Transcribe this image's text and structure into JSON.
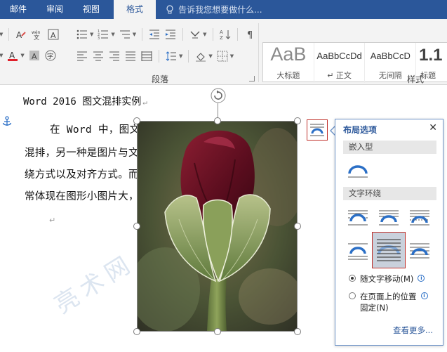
{
  "tabs": [
    {
      "label": "邮件"
    },
    {
      "label": "审阅"
    },
    {
      "label": "视图"
    },
    {
      "label": "格式",
      "active": true
    }
  ],
  "tell_me": {
    "text": "告诉我您想要做什么..."
  },
  "ribbon": {
    "paragraph_group_label": "段落",
    "styles_group_label": "样式",
    "styles": [
      {
        "sample": "AaB",
        "name": "大标题"
      },
      {
        "sample": "AaBbCcDd",
        "name": "↵ 正文"
      },
      {
        "sample": "AaBbCcD",
        "name": "无间隔"
      },
      {
        "sample": "1.1",
        "name": "标题"
      }
    ]
  },
  "document": {
    "title": "Word 2016 图文混排实例",
    "lines": [
      "在 Word 中，图文混排有两种情况，一种是图",
      "混排，另一种是图片与文字混排。二者与文字混排主要",
      "绕方式以及对齐方式。而图形与文字混排跟图片与文字",
      "常体现在图形小图片大，对于太大的图片需要把它适当"
    ]
  },
  "watermark": {
    "text": "亮术网"
  },
  "layout_pane": {
    "title": "布局选项",
    "close": "✕",
    "inline_section": "嵌入型",
    "wrap_section": "文字环绕",
    "move_with_text": "随文字移动(M)",
    "fix_position_line1": "在页面上的位置",
    "fix_position_line2": "固定(N)",
    "see_more": "查看更多...",
    "selected_option": "move_with_text"
  },
  "colors": {
    "accent": "#2b579a",
    "highlight_border": "#c0312b",
    "selected_tile": "#c9d1dc"
  }
}
